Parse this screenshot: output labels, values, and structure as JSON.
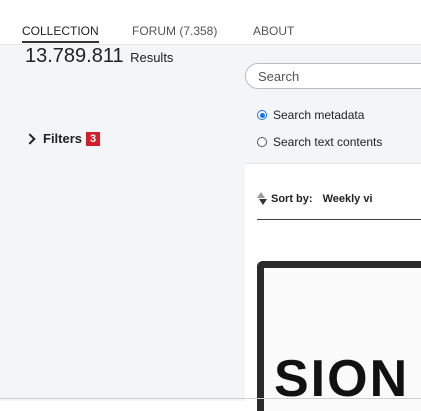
{
  "nav": {
    "tabs": [
      {
        "label": "COLLECTION"
      },
      {
        "label": "FORUM (7.358)"
      },
      {
        "label": "ABOUT"
      }
    ]
  },
  "results": {
    "count": "13.789.811",
    "label": "Results"
  },
  "filters": {
    "label": "Filters",
    "badge": "3"
  },
  "search": {
    "placeholder": "Search",
    "options": [
      {
        "label": "Search metadata",
        "selected": true
      },
      {
        "label": "Search text contents",
        "selected": false
      }
    ]
  },
  "sort": {
    "label": "Sort by:",
    "value": "Weekly vi"
  },
  "thumbnail": {
    "text": "SION"
  },
  "colors": {
    "badge": "#d11f2c",
    "radio_selected": "#1a73e8",
    "sidebar_bg": "#f4f5f7"
  }
}
